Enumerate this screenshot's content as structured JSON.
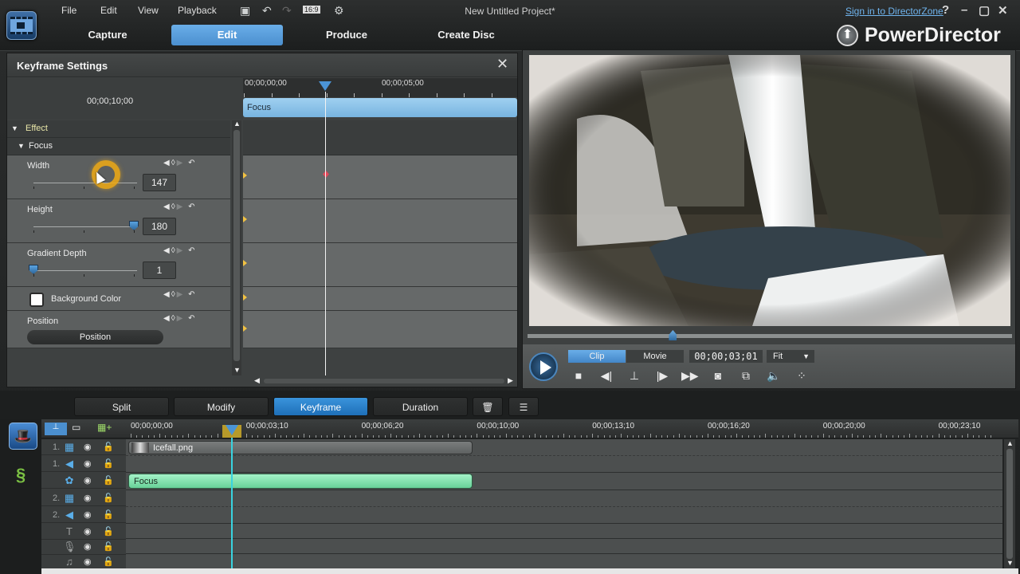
{
  "window": {
    "title": "New Untitled Project*",
    "sign_in": "Sign in to DirectorZone",
    "help": "?",
    "minimize": "–",
    "maximize": "▢",
    "close": "✕",
    "brand": "PowerDirector"
  },
  "menu": [
    "File",
    "Edit",
    "View",
    "Playback"
  ],
  "toolbar_icons": [
    "save-icon",
    "undo-icon",
    "redo-icon",
    "aspect-ratio-16-9-icon",
    "settings-icon"
  ],
  "aspect_ratio": "16:9",
  "mode_tabs": [
    {
      "label": "Capture",
      "active": false
    },
    {
      "label": "Edit",
      "active": true
    },
    {
      "label": "Produce",
      "active": false
    },
    {
      "label": "Create Disc",
      "active": false
    }
  ],
  "keyframe_panel": {
    "title": "Keyframe Settings",
    "duration": "00;00;10;00",
    "ruler_labels": [
      "00;00;00;00",
      "00;00;05;00"
    ],
    "clip_label": "Focus",
    "groups": [
      {
        "label": "Effect"
      },
      {
        "label": "Focus"
      }
    ],
    "params": [
      {
        "name": "Width",
        "value": "147",
        "slider_fraction": 0.6
      },
      {
        "name": "Height",
        "value": "180",
        "slider_fraction": 1.0
      },
      {
        "name": "Gradient Depth",
        "value": "1",
        "slider_fraction": 0.0
      },
      {
        "name": "Background Color",
        "color": "#ffffff"
      },
      {
        "name": "Position",
        "button": "Position"
      }
    ]
  },
  "preview": {
    "modes": [
      "Clip",
      "Movie"
    ],
    "active_mode": "Clip",
    "timecode": "00;00;03;01",
    "zoom": "Fit",
    "scrub_fraction": 0.3
  },
  "tools": [
    {
      "label": "Split",
      "active": false
    },
    {
      "label": "Modify",
      "active": false
    },
    {
      "label": "Keyframe",
      "active": true
    },
    {
      "label": "Duration",
      "active": false
    }
  ],
  "timeline": {
    "ruler_labels": [
      "00;00;00;00",
      "00;00;03;10",
      "00;00;06;20",
      "00;00;10;00",
      "00;00;13;10",
      "00;00;16;20",
      "00;00;20;00",
      "00;00;23;10"
    ],
    "tracks": [
      {
        "num": "1.",
        "type": "video-track-icon",
        "glyph": "▦"
      },
      {
        "num": "1.",
        "type": "audio-track-icon",
        "glyph": "◀"
      },
      {
        "num": "",
        "type": "effect-track-icon",
        "glyph": "✿"
      },
      {
        "num": "2.",
        "type": "video-track-icon",
        "glyph": "▦"
      },
      {
        "num": "2.",
        "type": "audio-track-icon",
        "glyph": "◀"
      },
      {
        "num": "",
        "type": "title-track-icon",
        "glyph": "T"
      },
      {
        "num": "",
        "type": "voice-track-icon",
        "glyph": "🎙"
      },
      {
        "num": "",
        "type": "music-track-icon",
        "glyph": "♫"
      }
    ],
    "clips": [
      {
        "label": "Icefall.png",
        "track": 0
      },
      {
        "label": "Focus",
        "track": 2
      }
    ]
  },
  "colors": {
    "accent": "#4b94d6",
    "effect_clip": "#7ddbac",
    "playhead": "#39d3e0",
    "keyframe": "#f2c242",
    "keyframe_active": "#e0485a"
  }
}
